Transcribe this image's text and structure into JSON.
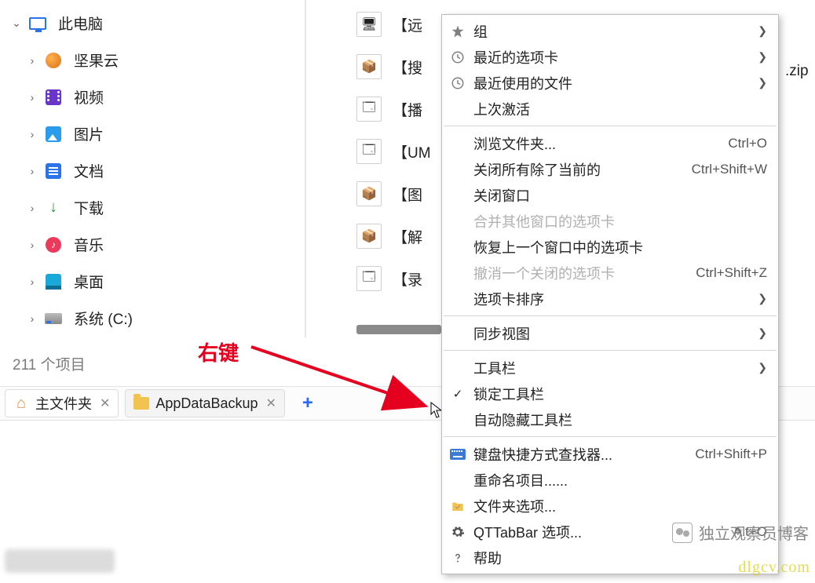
{
  "tree": {
    "root": {
      "label": "此电脑"
    },
    "items": [
      {
        "label": "坚果云"
      },
      {
        "label": "视频"
      },
      {
        "label": "图片"
      },
      {
        "label": "文档"
      },
      {
        "label": "下载"
      },
      {
        "label": "音乐"
      },
      {
        "label": "桌面"
      },
      {
        "label": "系统 (C:)"
      }
    ]
  },
  "status": {
    "count_text": "211 个项目"
  },
  "tabs": {
    "items": [
      {
        "label": "主文件夹"
      },
      {
        "label": "AppDataBackup"
      }
    ],
    "add_label": "+"
  },
  "files": {
    "rows": [
      {
        "label": "【远"
      },
      {
        "label": "【搜"
      },
      {
        "label": "【播"
      },
      {
        "label": "【UM"
      },
      {
        "label": "【图"
      },
      {
        "label": "【解"
      },
      {
        "label": "【录"
      }
    ],
    "trailing": ".zip"
  },
  "annotation": {
    "label": "右键"
  },
  "context_menu": {
    "items": [
      {
        "kind": "item",
        "icon": "star",
        "label": "组",
        "arrow": true
      },
      {
        "kind": "item",
        "icon": "clock",
        "label": "最近的选项卡",
        "arrow": true
      },
      {
        "kind": "item",
        "icon": "clock",
        "label": "最近使用的文件",
        "arrow": true
      },
      {
        "kind": "item",
        "label": "上次激活"
      },
      {
        "kind": "sep"
      },
      {
        "kind": "item",
        "label": "浏览文件夹...",
        "shortcut": "Ctrl+O"
      },
      {
        "kind": "item",
        "label": "关闭所有除了当前的",
        "shortcut": "Ctrl+Shift+W"
      },
      {
        "kind": "item",
        "label": "关闭窗口"
      },
      {
        "kind": "item",
        "label": "合并其他窗口的选项卡",
        "disabled": true
      },
      {
        "kind": "item",
        "label": "恢复上一个窗口中的选项卡"
      },
      {
        "kind": "item",
        "label": "撤消一个关闭的选项卡",
        "shortcut": "Ctrl+Shift+Z",
        "disabled": true
      },
      {
        "kind": "item",
        "label": "选项卡排序",
        "arrow": true
      },
      {
        "kind": "sep"
      },
      {
        "kind": "item",
        "label": "同步视图",
        "arrow": true
      },
      {
        "kind": "sep"
      },
      {
        "kind": "item",
        "label": "工具栏",
        "arrow": true
      },
      {
        "kind": "item",
        "label": "锁定工具栏",
        "checked": true
      },
      {
        "kind": "item",
        "label": "自动隐藏工具栏"
      },
      {
        "kind": "sep"
      },
      {
        "kind": "item",
        "icon": "keyboard",
        "label": "键盘快捷方式查找器...",
        "shortcut": "Ctrl+Shift+P"
      },
      {
        "kind": "item",
        "label": "重命名项目......"
      },
      {
        "kind": "item",
        "icon": "folderopt",
        "label": "文件夹选项..."
      },
      {
        "kind": "item",
        "icon": "gear",
        "label": "QTTabBar 选项...",
        "shortcut": "Alt+O"
      },
      {
        "kind": "item",
        "icon": "help",
        "label": "帮助"
      }
    ]
  },
  "watermark": {
    "text": "独立观察员博客",
    "url": "dlgcv.com"
  }
}
